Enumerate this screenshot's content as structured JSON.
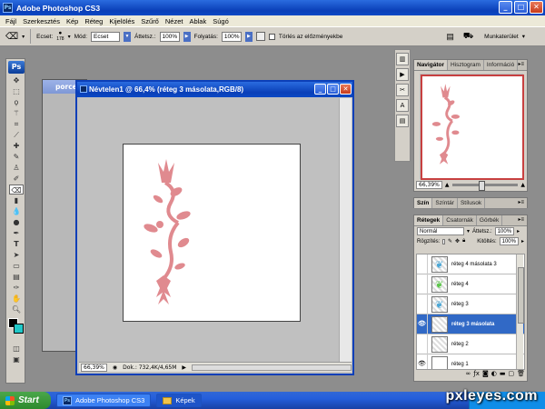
{
  "app": {
    "title": "Adobe Photoshop CS3",
    "logo": "Ps"
  },
  "window_buttons": {
    "minimize": "_",
    "maximize": "□",
    "close": "✕"
  },
  "menu": [
    "Fájl",
    "Szerkesztés",
    "Kép",
    "Réteg",
    "Kijelölés",
    "Szűrő",
    "Nézet",
    "Ablak",
    "Súgó"
  ],
  "options": {
    "brush_label": "Ecset:",
    "brush_size": "178",
    "mode_label": "Mód:",
    "mode_value": "Ecset",
    "opacity_label": "Áttetsz.:",
    "opacity_value": "100%",
    "flow_label": "Folyatás:",
    "flow_value": "100%",
    "history_checkbox": "Törlés az előzményekbe",
    "workspace": "Munkaterület"
  },
  "documents": {
    "back_title": "porce",
    "front_title": "Névtelen1 @ 66,4% (réteg 3 másolata,RGB/8)",
    "zoom": "66,39%",
    "doc_info": "Dok.: 732,4K/4,65M"
  },
  "navigator": {
    "tabs": [
      "Navigátor",
      "Hisztogram",
      "Információ"
    ],
    "zoom": "66,39%"
  },
  "color_panel": {
    "tabs": [
      "Szín",
      "Színtár",
      "Stílusok"
    ]
  },
  "layers_panel": {
    "tabs": [
      "Rétegek",
      "Csatornák",
      "Görbék"
    ],
    "blend_mode": "Normál",
    "opacity_label": "Áttetsz.:",
    "opacity_value": "100%",
    "lock_label": "Rögzítés:",
    "fill_label": "Kitöltés:",
    "fill_value": "100%",
    "layers": [
      {
        "name": "réteg 4 másolata 3",
        "visible": false,
        "thumb": "butterfly-blue",
        "selected": false
      },
      {
        "name": "réteg 4",
        "visible": false,
        "thumb": "butterfly-green",
        "selected": false
      },
      {
        "name": "réteg 3",
        "visible": false,
        "thumb": "butterfly-blue",
        "selected": false
      },
      {
        "name": "réteg 3 másolata",
        "visible": true,
        "thumb": "empty",
        "selected": true
      },
      {
        "name": "réteg 2",
        "visible": false,
        "thumb": "empty",
        "selected": false
      },
      {
        "name": "réteg 1",
        "visible": true,
        "thumb": "white",
        "selected": false
      }
    ]
  },
  "taskbar": {
    "start": "Start",
    "items": [
      "Adobe Photoshop CS3",
      "Képek"
    ]
  },
  "watermark": "pxleyes.com",
  "colors": {
    "ornament": "#e08a8f",
    "accent": "#2a6cdf",
    "selection": "#3169c6",
    "background_color": "#20c8c8"
  }
}
